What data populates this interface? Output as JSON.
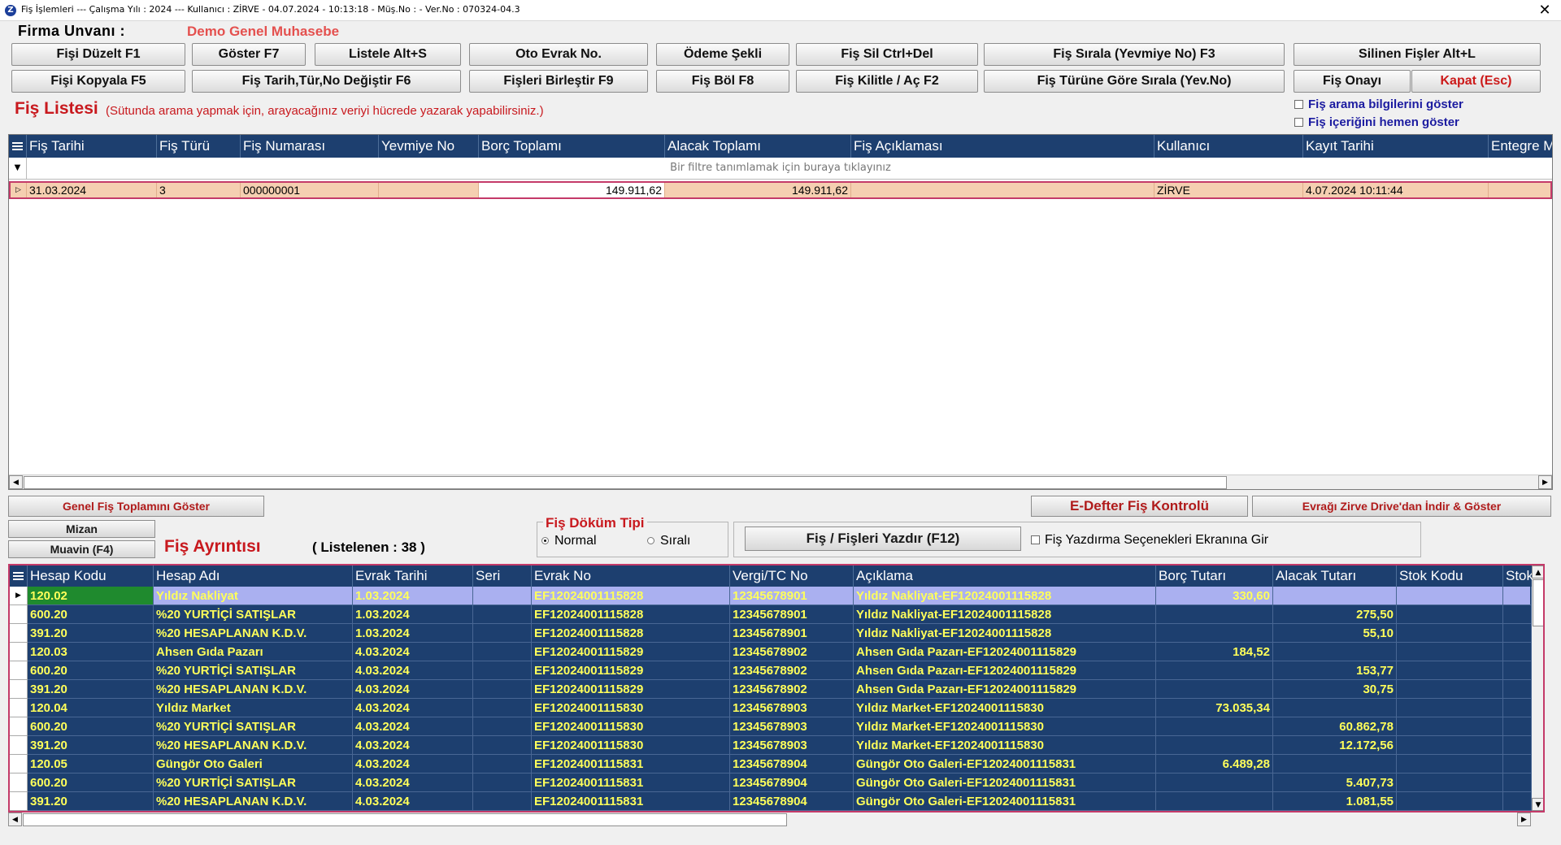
{
  "window": {
    "title": "Fiş İşlemleri  ---  Çalışma Yılı : 2024  ---  Kullanıcı : ZİRVE - 04.07.2024 - 10:13:18 - Müş.No :  - Ver.No : 070324-04.3",
    "close": "✕"
  },
  "firma": {
    "label": "Firma  Unvanı :",
    "name": "Demo Genel Muhasebe"
  },
  "toolbar": {
    "row1": [
      "Fişi Düzelt F1",
      "Göster F7",
      "Listele Alt+S",
      "Oto Evrak No.",
      "Ödeme Şekli",
      "Fiş Sil Ctrl+Del",
      "Fiş Sırala (Yevmiye No) F3",
      "Silinen Fişler Alt+L"
    ],
    "row2": [
      "Fişi Kopyala F5",
      "Fiş Tarih,Tür,No Değiştir F6",
      "Fişleri Birleştir F9",
      "Fiş Böl F8",
      "Fiş Kilitle / Aç F2",
      "Fiş Türüne Göre Sırala (Yev.No)",
      "Fiş Onayı",
      "Kapat (Esc)"
    ]
  },
  "fis_listesi": {
    "title": "Fiş Listesi",
    "hint": "(Sütunda arama yapmak için, arayacağınız veriyi hücrede yazarak yapabilirsiniz.)",
    "options": [
      "Fiş arama bilgilerini göster",
      "Fiş içeriğini hemen göster"
    ],
    "columns": [
      "Fiş Tarihi",
      "Fiş Türü",
      "Fiş Numarası",
      "Yevmiye No",
      "Borç Toplamı",
      "Alacak Toplamı",
      "Fiş Açıklaması",
      "Kullanıcı",
      "Kayıt Tarihi",
      "Entegre Mo"
    ],
    "filter_text": "Bir filtre tanımlamak için buraya tıklayınız",
    "rows": [
      [
        "31.03.2024",
        "3",
        "000000001",
        "",
        "149.911,62",
        "149.911,62",
        "",
        "ZİRVE",
        "4.07.2024 10:11:44",
        ""
      ]
    ]
  },
  "middle": {
    "genel_toplam": "Genel Fiş Toplamını Göster",
    "mizan": "Mizan",
    "muavin": "Muavin (F4)",
    "edefter": "E-Defter Fiş Kontrolü",
    "zirve_drive": "Evrağı Zirve Drive'dan İndir & Göster",
    "detail_title": "Fiş Ayrıntısı",
    "listed": "( Listelenen : 38 )",
    "dokum_title": "Fiş Döküm Tipi",
    "dokum_normal": "Normal",
    "dokum_sirali": "Sıralı",
    "print_button": "Fiş / Fişleri Yazdır (F12)",
    "print_option": "Fiş Yazdırma Seçenekleri Ekranına Gir"
  },
  "detay": {
    "columns": [
      "Hesap Kodu",
      "Hesap Adı",
      "Evrak Tarihi",
      "Seri",
      "Evrak No",
      "Vergi/TC No",
      "Açıklama",
      "Borç Tutarı",
      "Alacak Tutarı",
      "Stok Kodu",
      "Stok"
    ],
    "rows": [
      [
        "120.02",
        "Yıldız Nakliyat",
        "1.03.2024",
        "",
        "EF12024001115828",
        "12345678901",
        "Yıldız Nakliyat-EF12024001115828",
        "330,60",
        ""
      ],
      [
        "600.20",
        "%20 YURTİÇİ SATIŞLAR",
        "1.03.2024",
        "",
        "EF12024001115828",
        "12345678901",
        "Yıldız Nakliyat-EF12024001115828",
        "",
        "275,50"
      ],
      [
        "391.20",
        "%20 HESAPLANAN K.D.V.",
        "1.03.2024",
        "",
        "EF12024001115828",
        "12345678901",
        "Yıldız Nakliyat-EF12024001115828",
        "",
        "55,10"
      ],
      [
        "120.03",
        "Ahsen Gıda Pazarı",
        "4.03.2024",
        "",
        "EF12024001115829",
        "12345678902",
        "Ahsen Gıda Pazarı-EF12024001115829",
        "184,52",
        ""
      ],
      [
        "600.20",
        "%20 YURTİÇİ SATIŞLAR",
        "4.03.2024",
        "",
        "EF12024001115829",
        "12345678902",
        "Ahsen Gıda Pazarı-EF12024001115829",
        "",
        "153,77"
      ],
      [
        "391.20",
        "%20 HESAPLANAN K.D.V.",
        "4.03.2024",
        "",
        "EF12024001115829",
        "12345678902",
        "Ahsen Gıda Pazarı-EF12024001115829",
        "",
        "30,75"
      ],
      [
        "120.04",
        "Yıldız Market",
        "4.03.2024",
        "",
        "EF12024001115830",
        "12345678903",
        "Yıldız Market-EF12024001115830",
        "73.035,34",
        ""
      ],
      [
        "600.20",
        "%20 YURTİÇİ SATIŞLAR",
        "4.03.2024",
        "",
        "EF12024001115830",
        "12345678903",
        "Yıldız Market-EF12024001115830",
        "",
        "60.862,78"
      ],
      [
        "391.20",
        "%20 HESAPLANAN K.D.V.",
        "4.03.2024",
        "",
        "EF12024001115830",
        "12345678903",
        "Yıldız Market-EF12024001115830",
        "",
        "12.172,56"
      ],
      [
        "120.05",
        "Güngör Oto Galeri",
        "4.03.2024",
        "",
        "EF12024001115831",
        "12345678904",
        "Güngör Oto Galeri-EF12024001115831",
        "6.489,28",
        ""
      ],
      [
        "600.20",
        "%20 YURTİÇİ SATIŞLAR",
        "4.03.2024",
        "",
        "EF12024001115831",
        "12345678904",
        "Güngör Oto Galeri-EF12024001115831",
        "",
        "5.407,73"
      ],
      [
        "391.20",
        "%20 HESAPLANAN K.D.V.",
        "4.03.2024",
        "",
        "EF12024001115831",
        "12345678904",
        "Güngör Oto Galeri-EF12024001115831",
        "",
        "1.081,55"
      ]
    ]
  },
  "colors": {
    "grid_header": "#1d3f6f",
    "grid_text_yellow": "#ffff5a",
    "selected_row": "#f5cfb1",
    "accent_red": "#c8191e",
    "highlight_border": "#c43a69"
  }
}
